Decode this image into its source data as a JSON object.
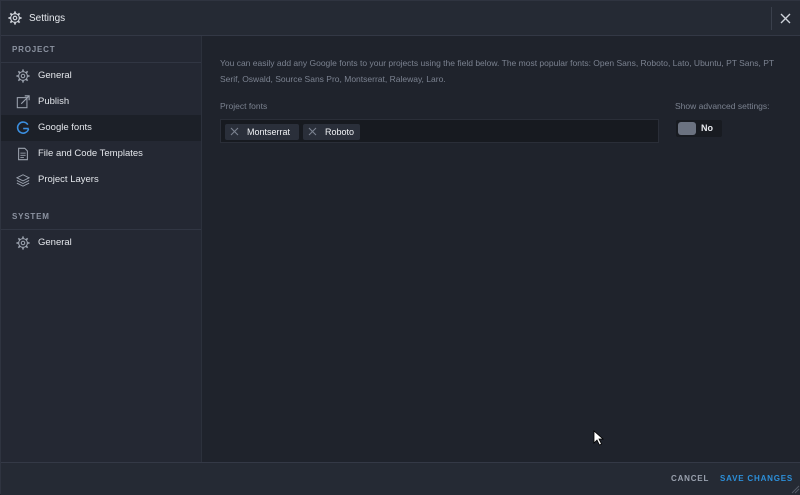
{
  "window": {
    "title": "Settings"
  },
  "sidebar": {
    "project_section": "PROJECT",
    "project_items": [
      {
        "label": "General",
        "icon": "gear-icon",
        "active": false
      },
      {
        "label": "Publish",
        "icon": "publish-icon",
        "active": false
      },
      {
        "label": "Google fonts",
        "icon": "google-icon",
        "active": true
      },
      {
        "label": "File and Code Templates",
        "icon": "file-template-icon",
        "active": false
      },
      {
        "label": "Project Layers",
        "icon": "layers-icon",
        "active": false
      }
    ],
    "system_section": "SYSTEM",
    "system_items": [
      {
        "label": "General",
        "icon": "gear-icon",
        "active": false
      }
    ]
  },
  "content": {
    "description": "You can easily add any Google fonts to your projects using the field below. The most popular fonts: Open Sans, Roboto, Lato, Ubuntu, PT Sans, PT Serif, Oswald, Source Sans Pro, Montserrat, Raleway, Laro.",
    "project_fonts_label": "Project fonts",
    "fonts": [
      "Montserrat",
      "Roboto"
    ],
    "advanced_label": "Show advanced settings:",
    "advanced_toggle_value": "No"
  },
  "footer": {
    "cancel_label": "CANCEL",
    "save_label": "SAVE CHANGES"
  },
  "colors": {
    "accent": "#2c8fd9",
    "google_icon": "#3b8fe0",
    "background": "#1f232c",
    "sidebar": "#242833"
  }
}
